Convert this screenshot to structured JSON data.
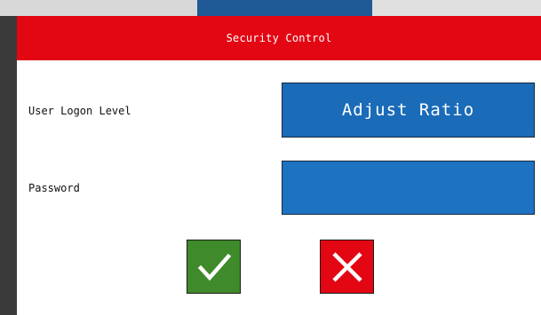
{
  "dialog": {
    "title": "Security Control",
    "logon_level_label": "User Logon Level",
    "logon_level_value": "Adjust Ratio",
    "password_label": "Password",
    "password_value": "",
    "ok_icon": "checkmark-icon",
    "cancel_icon": "x-icon"
  },
  "colors": {
    "titlebar": "#e30613",
    "field": "#1a6bb8",
    "ok": "#3f8a2b",
    "cancel": "#e30613"
  }
}
